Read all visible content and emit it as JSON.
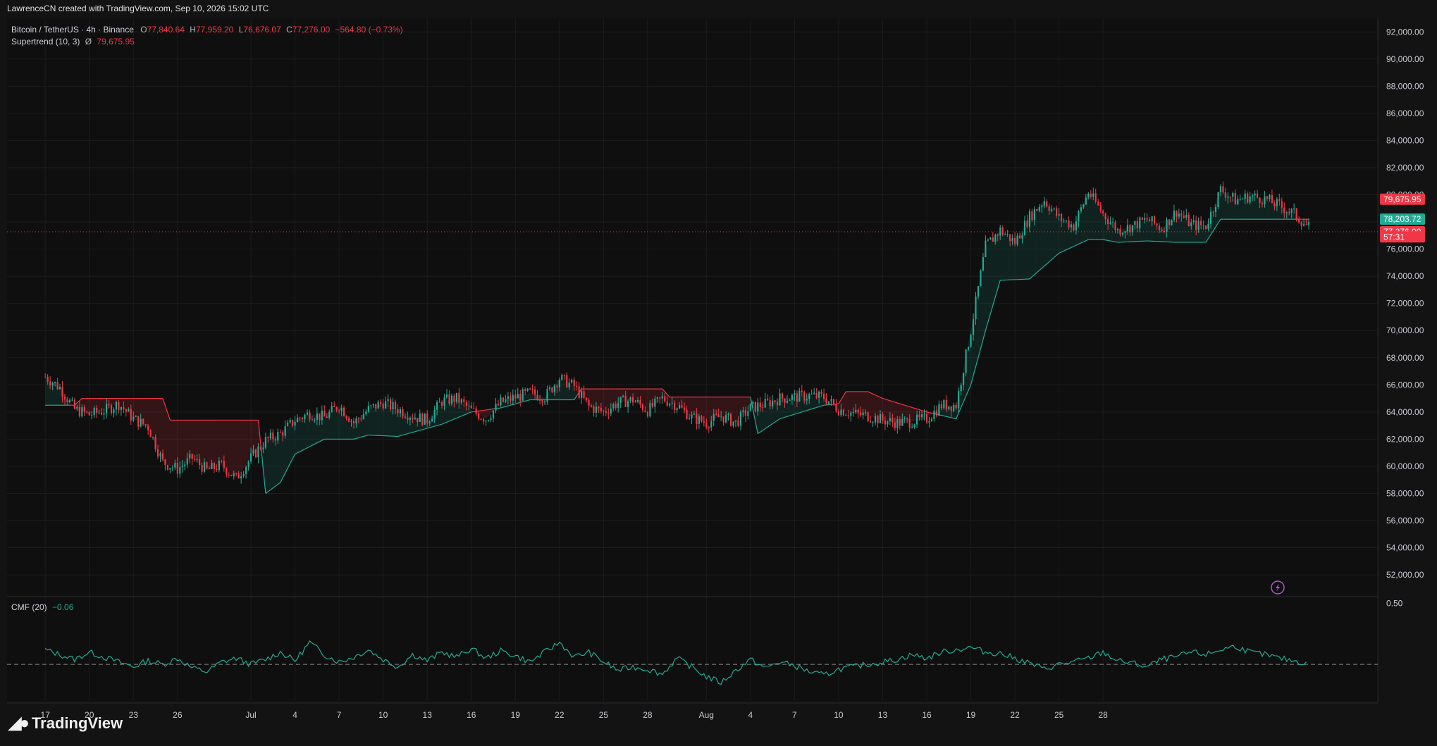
{
  "header": {
    "credit": "LawrenceCN created with TradingView.com, Sep 10, 2026 15:02 UTC"
  },
  "legend": {
    "symbol": "Bitcoin / TetherUS · 4h · Binance",
    "open_label": "O",
    "open": "77,840.64",
    "high_label": "H",
    "high": "77,959.20",
    "low_label": "L",
    "low": "76,676.07",
    "close_label": "C",
    "close": "77,276.00",
    "change": "−564.80 (−0.73%)",
    "indicator": "Supertrend (10, 3)",
    "indicator_icon": "eye-slash-icon",
    "indicator_value": "79,675.95"
  },
  "cmf": {
    "label": "CMF (20)",
    "value": "−0.06"
  },
  "price_tags": [
    {
      "text": "79,675.95",
      "value": 79675.95,
      "color": "#f23645"
    },
    {
      "text": "78,203.72",
      "value": 78203.72,
      "color": "#22ab94"
    },
    {
      "text": "77,276.00",
      "value": 77276,
      "color": "#f23645"
    },
    {
      "text": "57:31",
      "value": 76900,
      "color": "#f23645"
    }
  ],
  "brand": {
    "name": "TradingView",
    "icon": "tradingview-logo-icon"
  },
  "flash_icon": "lightning-icon",
  "chart_data": {
    "type": "candlestick",
    "title": "Bitcoin / TetherUS · 4h · Binance",
    "y_ticks": [
      "92,000.00",
      "90,000.00",
      "88,000.00",
      "86,000.00",
      "84,000.00",
      "82,000.00",
      "80,000.00",
      "78,000.00",
      "76,000.00",
      "74,000.00",
      "72,000.00",
      "70,000.00",
      "68,000.00",
      "66,000.00",
      "64,000.00",
      "62,000.00",
      "60,000.00",
      "58,000.00",
      "56,000.00",
      "54,000.00",
      "52,000.00"
    ],
    "y_tick_values": [
      92000,
      90000,
      88000,
      86000,
      84000,
      82000,
      80000,
      78000,
      76000,
      74000,
      72000,
      70000,
      68000,
      66000,
      64000,
      62000,
      60000,
      58000,
      56000,
      54000,
      52000
    ],
    "ylim": [
      50500,
      93000
    ],
    "x_ticks": [
      "17",
      "20",
      "23",
      "26",
      "Jul",
      "4",
      "7",
      "10",
      "13",
      "16",
      "19",
      "22",
      "25",
      "28",
      "Aug",
      "4",
      "7",
      "10",
      "13",
      "16",
      "19",
      "22",
      "25",
      "28"
    ],
    "x_day_index": [
      0,
      3,
      6,
      9,
      14,
      17,
      20,
      23,
      26,
      29,
      32,
      35,
      38,
      41,
      45,
      48,
      51,
      54,
      57,
      60,
      63,
      66,
      69,
      72
    ],
    "close_path": [
      [
        0,
        66600
      ],
      [
        1,
        65800
      ],
      [
        2,
        64200
      ],
      [
        3,
        63800
      ],
      [
        4,
        64100
      ],
      [
        5,
        64600
      ],
      [
        6,
        63500
      ],
      [
        7,
        62900
      ],
      [
        8,
        60300
      ],
      [
        9,
        59800
      ],
      [
        10,
        60600
      ],
      [
        11,
        59700
      ],
      [
        12,
        60100
      ],
      [
        13,
        59100
      ],
      [
        14,
        60600
      ],
      [
        15,
        61900
      ],
      [
        16,
        62400
      ],
      [
        17,
        63400
      ],
      [
        18,
        63900
      ],
      [
        19,
        63600
      ],
      [
        20,
        64500
      ],
      [
        21,
        63200
      ],
      [
        22,
        64200
      ],
      [
        23,
        64700
      ],
      [
        24,
        64200
      ],
      [
        25,
        63700
      ],
      [
        26,
        63400
      ],
      [
        27,
        64800
      ],
      [
        28,
        65000
      ],
      [
        29,
        64100
      ],
      [
        30,
        63500
      ],
      [
        31,
        64700
      ],
      [
        32,
        65100
      ],
      [
        33,
        65400
      ],
      [
        34,
        65100
      ],
      [
        35,
        66500
      ],
      [
        36,
        65900
      ],
      [
        37,
        64400
      ],
      [
        38,
        64000
      ],
      [
        39,
        64700
      ],
      [
        40,
        64900
      ],
      [
        41,
        64100
      ],
      [
        42,
        65000
      ],
      [
        43,
        64500
      ],
      [
        44,
        63600
      ],
      [
        45,
        63200
      ],
      [
        46,
        63700
      ],
      [
        47,
        63200
      ],
      [
        48,
        64300
      ],
      [
        49,
        64600
      ],
      [
        50,
        65000
      ],
      [
        51,
        65100
      ],
      [
        52,
        65200
      ],
      [
        53,
        65100
      ],
      [
        54,
        64200
      ],
      [
        55,
        63900
      ],
      [
        56,
        63700
      ],
      [
        57,
        63400
      ],
      [
        58,
        63200
      ],
      [
        59,
        63300
      ],
      [
        60,
        63500
      ],
      [
        61,
        64500
      ],
      [
        62,
        64500
      ],
      [
        63,
        70000
      ],
      [
        64,
        76200
      ],
      [
        65,
        77400
      ],
      [
        66,
        76500
      ],
      [
        67,
        78400
      ],
      [
        68,
        79600
      ],
      [
        69,
        78300
      ],
      [
        70,
        77700
      ],
      [
        71,
        80200
      ],
      [
        72,
        78600
      ],
      [
        73,
        77400
      ],
      [
        74,
        77700
      ],
      [
        75,
        78200
      ],
      [
        76,
        77500
      ],
      [
        77,
        78800
      ],
      [
        78,
        77800
      ],
      [
        79,
        77700
      ],
      [
        80,
        80400
      ],
      [
        81,
        79600
      ],
      [
        82,
        79900
      ],
      [
        83,
        79700
      ],
      [
        84,
        79200
      ],
      [
        85,
        78600
      ],
      [
        86,
        77600
      ]
    ],
    "supertrend": [
      [
        0,
        64500
      ],
      [
        2,
        64500
      ],
      [
        2.5,
        65000
      ],
      [
        8,
        65000
      ],
      [
        8.5,
        63400
      ],
      [
        14.5,
        63400
      ],
      [
        15,
        58000
      ],
      [
        16,
        58800
      ],
      [
        17,
        60900
      ],
      [
        19,
        62000
      ],
      [
        21,
        62000
      ],
      [
        22,
        62300
      ],
      [
        24,
        62200
      ],
      [
        27,
        63100
      ],
      [
        29,
        64000
      ],
      [
        31,
        64300
      ],
      [
        33,
        64900
      ],
      [
        36,
        64900
      ],
      [
        36.5,
        65700
      ],
      [
        42,
        65700
      ],
      [
        42.5,
        65100
      ],
      [
        48,
        65100
      ],
      [
        48.5,
        62400
      ],
      [
        50,
        63500
      ],
      [
        53,
        64500
      ],
      [
        54,
        64600
      ],
      [
        54.5,
        65500
      ],
      [
        56,
        65500
      ],
      [
        57,
        65000
      ],
      [
        60,
        64000
      ],
      [
        62,
        63500
      ],
      [
        63,
        66000
      ],
      [
        64,
        70000
      ],
      [
        65,
        73700
      ],
      [
        67,
        73800
      ],
      [
        69,
        75700
      ],
      [
        71,
        76700
      ],
      [
        72,
        76700
      ],
      [
        73,
        76500
      ],
      [
        75,
        76600
      ],
      [
        77,
        76500
      ],
      [
        79,
        76500
      ],
      [
        80,
        78200
      ],
      [
        86,
        78200
      ]
    ],
    "cmf_series": [
      0.12,
      0.08,
      0.04,
      0.1,
      0.06,
      0.02,
      -0.02,
      0.03,
      0.0,
      0.05,
      -0.03,
      -0.06,
      0.02,
      0.05,
      0.0,
      0.04,
      0.1,
      0.03,
      0.18,
      0.08,
      0.02,
      0.06,
      0.12,
      0.04,
      -0.02,
      0.08,
      0.03,
      0.1,
      0.06,
      0.13,
      0.05,
      0.11,
      0.07,
      0.02,
      0.1,
      0.18,
      0.06,
      0.1,
      0.02,
      -0.05,
      -0.02,
      -0.04,
      -0.08,
      0.05,
      -0.02,
      -0.1,
      -0.15,
      -0.05,
      0.04,
      -0.03,
      0.02,
      -0.01,
      -0.06,
      -0.09,
      -0.04,
      -0.02,
      0.0,
      0.02,
      0.04,
      0.08,
      0.05,
      0.1,
      0.12,
      0.14,
      0.1,
      0.09,
      0.05,
      0.01,
      -0.04,
      0.0,
      0.02,
      0.05,
      0.1,
      0.03,
      0.01,
      -0.02,
      0.04,
      0.06,
      0.1,
      0.08,
      0.12,
      0.15,
      0.1,
      0.08,
      0.05,
      0.03,
      0.0
    ],
    "cmf_zero_label": "0.50",
    "cmf_zero_value": 0.5,
    "cmf_ylim": [
      -0.3,
      0.55
    ]
  }
}
